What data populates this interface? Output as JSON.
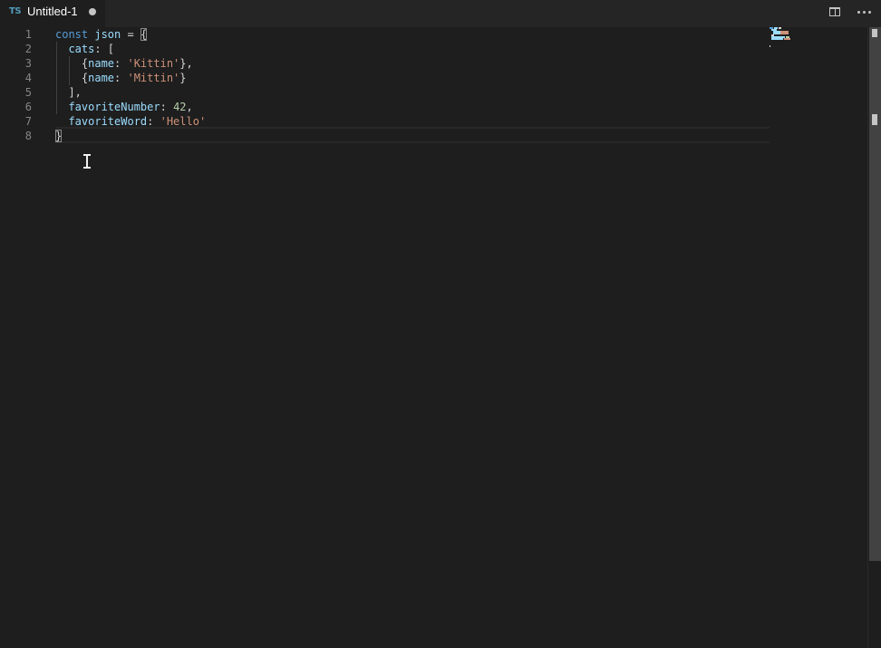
{
  "tab": {
    "language_badge": "TS",
    "title": "Untitled-1",
    "dirty": true
  },
  "toolbar": {
    "split_editor_icon": "split-editor-icon",
    "more_actions_icon": "more-actions-icon"
  },
  "editor": {
    "line_numbers": [
      "1",
      "2",
      "3",
      "4",
      "5",
      "6",
      "7",
      "8"
    ],
    "lines": [
      [
        {
          "t": "const",
          "c": "kw"
        },
        {
          "t": " ",
          "c": "punc"
        },
        {
          "t": "json",
          "c": "var"
        },
        {
          "t": " = ",
          "c": "punc"
        },
        {
          "t": "{",
          "c": "punc hl"
        }
      ],
      [
        {
          "t": "  ",
          "c": "punc"
        },
        {
          "t": "cats",
          "c": "var"
        },
        {
          "t": ": [",
          "c": "punc"
        }
      ],
      [
        {
          "t": "    {",
          "c": "punc"
        },
        {
          "t": "name",
          "c": "var"
        },
        {
          "t": ": ",
          "c": "punc"
        },
        {
          "t": "'Kittin'",
          "c": "str"
        },
        {
          "t": "},",
          "c": "punc"
        }
      ],
      [
        {
          "t": "    {",
          "c": "punc"
        },
        {
          "t": "name",
          "c": "var"
        },
        {
          "t": ": ",
          "c": "punc"
        },
        {
          "t": "'Mittin'",
          "c": "str"
        },
        {
          "t": "}",
          "c": "punc"
        }
      ],
      [
        {
          "t": "  ],",
          "c": "punc"
        }
      ],
      [
        {
          "t": "  ",
          "c": "punc"
        },
        {
          "t": "favoriteNumber",
          "c": "var"
        },
        {
          "t": ": ",
          "c": "punc"
        },
        {
          "t": "42",
          "c": "num"
        },
        {
          "t": ",",
          "c": "punc"
        }
      ],
      [
        {
          "t": "  ",
          "c": "punc"
        },
        {
          "t": "favoriteWord",
          "c": "var"
        },
        {
          "t": ": ",
          "c": "punc"
        },
        {
          "t": "'Hello'",
          "c": "str"
        }
      ],
      [
        {
          "t": "}",
          "c": "punc hl"
        }
      ]
    ]
  },
  "colors": {
    "background": "#1e1e1e",
    "tabbar": "#252526",
    "keyword": "#569cd6",
    "variable": "#9cdcfe",
    "string": "#ce9178",
    "number": "#b5cea8",
    "line_number": "#858585",
    "ts_badge": "#519aba"
  }
}
